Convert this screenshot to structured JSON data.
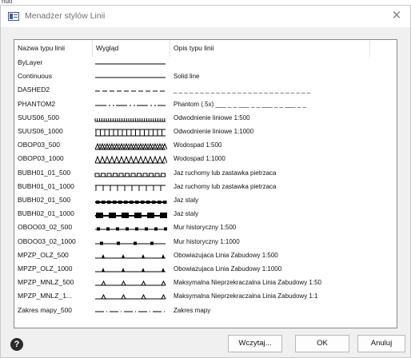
{
  "window": {
    "title": "Menadżer stylów Linii",
    "close_glyph": "✕",
    "background_label": "nuo"
  },
  "table": {
    "headers": [
      "Nazwa typu linii",
      "Wygląd",
      "Opis typu linii",
      ""
    ],
    "rows": [
      {
        "name": "ByLayer",
        "pattern": "solid",
        "description": ""
      },
      {
        "name": "Continuous",
        "pattern": "solid",
        "description": "Solid line"
      },
      {
        "name": "DASHED2",
        "pattern": "dashed",
        "description": "_ _ _ _ _ _ _ _ _ _ _ _ _ _ _ _ _ _ _ _ _ _ _ _ _ _"
      },
      {
        "name": "PHANTOM2",
        "pattern": "phantom",
        "description": "Phantom (.5x) ___ _ _ ___ _ _ ___ _ _ ___ _ _"
      },
      {
        "name": "SUUS06_500",
        "pattern": "ticks_dense",
        "description": "Odwodnienie liniowe 1:500"
      },
      {
        "name": "SUUS06_1000",
        "pattern": "ticks_sparse",
        "description": "Odwodnienie liniowe 1:1000"
      },
      {
        "name": "OBOP03_500",
        "pattern": "zigzag_dense",
        "description": "Wodospad 1:500"
      },
      {
        "name": "OBOP03_1000",
        "pattern": "zigzag_sparse",
        "description": "Wodospad 1:1000"
      },
      {
        "name": "BUBH01_01_500",
        "pattern": "squares_small",
        "description": "Jaz ruchomy lub zastawka pietrzaca"
      },
      {
        "name": "BUBH01_01_1000",
        "pattern": "ticks_up",
        "description": "Jaz ruchomy lub zastawka pietrzaca"
      },
      {
        "name": "BUBH02_01_500",
        "pattern": "blocks_small",
        "description": "Jaz staly"
      },
      {
        "name": "BUBH02_01_1000",
        "pattern": "blocks_large",
        "description": "Jaz staly"
      },
      {
        "name": "OBOO03_02_500",
        "pattern": "dots_dense",
        "description": "Mur historyczny 1:500"
      },
      {
        "name": "OBOO03_02_1000",
        "pattern": "dots_sparse",
        "description": "Mur historyczny 1:1000"
      },
      {
        "name": "MPZP_OLZ_500",
        "pattern": "triangles_filled",
        "description": "Obowiazujaca Linia Zabudowy 1:500"
      },
      {
        "name": "MPZP_OLZ_1000",
        "pattern": "triangles_filled",
        "description": "Obowiazujaca Linia Zabudowy 1:1000"
      },
      {
        "name": "MPZP_MNLZ_500",
        "pattern": "triangles_open",
        "description": "Maksymalna Nieprzekraczalna Linia Zabudowy 1:50"
      },
      {
        "name": "MPZP_MNLZ_1...",
        "pattern": "triangles_open",
        "description": "Maksymalna Nieprzekraczalna Linia Zabudowy 1:1"
      },
      {
        "name": "Zakres mapy_500",
        "pattern": "dash_dot",
        "description": "Zakres mapy"
      }
    ]
  },
  "footer": {
    "help_glyph": "?",
    "load_label": "Wczytaj...",
    "ok_label": "OK",
    "cancel_label": "Anuluj"
  }
}
